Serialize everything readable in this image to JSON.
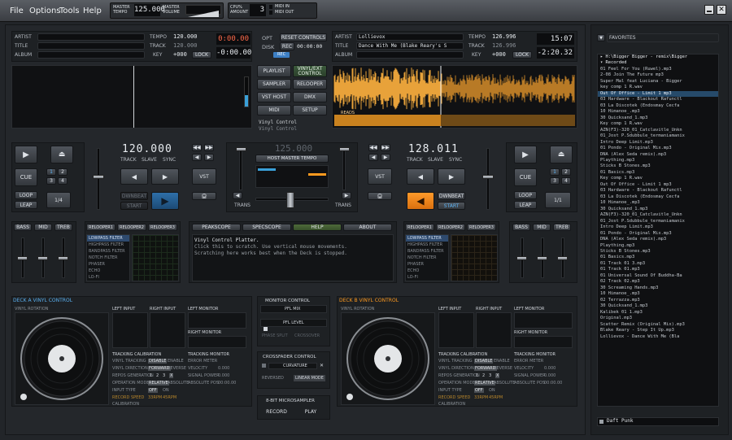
{
  "menu": {
    "file": "File",
    "options": "Options",
    "tools": "Tools",
    "help": "Help"
  },
  "topbar": {
    "master_tempo_label": "MASTER TEMPO",
    "master_tempo_value": "125.000",
    "master_volume_label": "MASTER VOLUME",
    "cpu_label": "CPU% AMOUNT",
    "cpu_value": "3",
    "midi_in": "MIDI IN",
    "midi_out": "MIDI OUT"
  },
  "deckA": {
    "artist_label": "ARTIST",
    "title_label": "TITLE",
    "album_label": "ALBUM",
    "tempo_label": "TEMPO",
    "tempo_value": "120.000",
    "track_label": "TRACK",
    "track_value": "120.000",
    "key_label": "KEY",
    "key_value": "+000",
    "lock": "LOCK",
    "time1": "0:00.00",
    "time2": "-0:00.00",
    "bpm": "120.000",
    "track_btn": "TRACK",
    "slave_btn": "SLAVE",
    "sync_btn": "SYNC",
    "cue": "CUE",
    "loop": "LOOP",
    "leap": "LEAP",
    "loop_val": "1/4",
    "dwnbeat": "DWNBEAT",
    "start": "START",
    "vst": "VST",
    "cue_nums": [
      "1",
      "2",
      "3",
      "4"
    ]
  },
  "deckB": {
    "artist_label": "ARTIST",
    "artist_value": "Lollievox",
    "title_label": "TITLE",
    "title_value": "Dance With Me (Blake Reary's S",
    "album_label": "ALBUM",
    "tempo_label": "TEMPO",
    "tempo_value": "126.996",
    "track_label": "TRACK",
    "track_value": "126.996",
    "key_label": "KEY",
    "key_value": "+000",
    "lock": "LOCK",
    "time1": "15:07",
    "time2": "-2:20.32",
    "bpm": "128.011",
    "track_btn": "TRACK",
    "slave_btn": "SLAVE",
    "sync_btn": "SYNC",
    "cue": "CUE",
    "loop": "LOOP",
    "leap": "LEAP",
    "loop_val": "1/1",
    "dwnbeat": "DWNBEAT",
    "start": "START",
    "vst": "VST",
    "cue_nums": [
      "1",
      "2",
      "3",
      "4"
    ],
    "reads": "READS"
  },
  "center": {
    "opt": "OPT",
    "reset": "RESET CONTROLS",
    "disk": "DISK",
    "rec": "REC",
    "rec_time": "00:00:00",
    "rec_badge": "REC",
    "playlist": "PLAYLIST",
    "vinyl_ext": "VINYL/EXT CONTROL",
    "sampler": "SAMPLER",
    "relooper": "RELOOPER",
    "vst_host": "VST HOST",
    "dmx": "DMX",
    "midi": "MIDI",
    "setup": "SETUP",
    "vinyl_line1": "Vinyl Control",
    "vinyl_line2": "Vinyl Control",
    "master_bpm": "125.000",
    "host_master_tempo": "HOST MASTER TEMPO",
    "trans": "TRANS"
  },
  "fx": {
    "bass": "BASS",
    "mid": "MID",
    "treb": "TREB",
    "relooper1": "RELOOPER1",
    "relooper2": "RELOOPER2",
    "relooper3": "RELOOPER3",
    "effects": [
      "LOWPASS FILTER",
      "HIGHPASS FILTER",
      "BANDPASS FILTER",
      "NOTCH FILTER",
      "PHASER",
      "ECHO",
      "LO-FI"
    ],
    "peakscope": "PEAKSCOPE",
    "specscope": "SPECSCOPE",
    "help": "HELP",
    "about": "ABOUT",
    "help_text1": "Vinyl Control Platter.",
    "help_text2": "Click this to scratch. Use vertical mouse movements.",
    "help_text3": "Scratching here works best when the Deck is stopped."
  },
  "vinylA": {
    "title": "DECK A VINYL CONTROL",
    "vinyl_rotation": "VINYL ROTATION",
    "left_input": "LEFT INPUT",
    "right_input": "RIGHT INPUT",
    "left_monitor": "LEFT MONITOR",
    "right_monitor": "RIGHT MONITOR",
    "tracking_cal": "TRACKING CALIBRATION",
    "tracking_mon": "TRACKING MONITOR",
    "rows": [
      [
        "VINYL TRACKING",
        "DISABLE",
        "ENABLE",
        "ERROR METER"
      ],
      [
        "VINYL DIRECTION",
        "FORWARD",
        "REVERSE",
        "VELOCITY",
        "0.000"
      ],
      [
        "REPOS GENERATION",
        "1",
        "2",
        "3",
        "X",
        "SIGNAL POWER",
        "0.000"
      ],
      [
        "OPERATION MODE",
        "RELATIVE",
        "ABSOLUTE",
        "ABSOLUTE POS",
        "00:00.00"
      ],
      [
        "INPUT TYPE",
        "OFF",
        "ON"
      ],
      [
        "RECORD SPEED",
        "33RPM",
        "45RPM"
      ],
      [
        "CALIBRATION"
      ]
    ]
  },
  "vinylB": {
    "title": "DECK B VINYL CONTROL",
    "vinyl_rotation": "VINYL ROTATION",
    "left_input": "LEFT INPUT",
    "right_input": "RIGHT INPUT",
    "left_monitor": "LEFT MONITOR",
    "right_monitor": "RIGHT MONITOR",
    "tracking_cal": "TRACKING CALIBRATION",
    "tracking_mon": "TRACKING MONITOR",
    "rows": [
      [
        "VINYL TRACKING",
        "DISABLE",
        "ENABLE",
        "ERROR METER"
      ],
      [
        "VINYL DIRECTION",
        "FORWARD",
        "REVERSE",
        "VELOCITY",
        "0.000"
      ],
      [
        "REPOS GENERATION",
        "1",
        "2",
        "3",
        "X",
        "SIGNAL POWER",
        "0.000"
      ],
      [
        "OPERATION MODE",
        "RELATIVE",
        "ABSOLUTE",
        "ABSOLUTE POS",
        "00:00.00"
      ],
      [
        "INPUT TYPE",
        "OFF",
        "ON"
      ],
      [
        "RECORD SPEED",
        "33RPM",
        "45RPM"
      ],
      [
        "CALIBRATION"
      ]
    ]
  },
  "monitor": {
    "title": "MONITOR CONTROL",
    "pfl_mix": "PFL MIX",
    "pfl_level": "PFL LEVEL",
    "phase_split": "PHASE SPLIT",
    "crossover": "CROSSOVER"
  },
  "crossfader": {
    "title": "CROSSFADER CONTROL",
    "curvature": "CURVATURE",
    "reversed": "REVERSED",
    "linear_mode": "LINEAR MODE"
  },
  "sampler": {
    "title": "8-BIT MICROSAMPLER",
    "record": "RECORD",
    "play": "PLAY"
  },
  "favorites": {
    "label": "FAVORITES",
    "path": "H:\\Bigger Bigger - remix\\Bigger",
    "recorded": "Recorded",
    "items": [
      "01 Feel For You (Ruwel).mp3",
      "2-08 Join The Future mp3",
      "Super Mal feat Luciana - Bigger",
      "key comp 1 R.wav",
      "Out Of Office - Limit 1 mp3",
      "03 Hardware - Blackout Rafunctl",
      "03 La Discotek (Endosmay Cecfa",
      "10 Himanoe_.mp3",
      "30 Quicksand_1.mp3",
      "Key comp 1 R.wav",
      "AZN(F3)-320_01_Catclavitle_Unkn",
      "01_Jost P.Sdubbule_termaniamanix",
      "Intro Deep Limit.mp3",
      "01 Pondo - Original Mix.mp3",
      "DNA (Alex Seda remix).mp3",
      "Plaything.mp3",
      "Sticks B Stones.mp3",
      "01 Basics.mp3",
      "Key comp 1 R.wav",
      "Out Of Office - Limit 1 mp3",
      "03 Hardware - Blackout Rafunctl",
      "03 La Discotek (Endosmay Cecfa",
      "10 Himanoe_.mp3",
      "30 Quicksand_1.mp3",
      "AZN(F3)-320_01_Catclavitle_Unkn",
      "01_Jost P.Sdubbule_termaniamanix",
      "Intro Deep Limit.mp3",
      "01 Pondo - Original Mix.mp3",
      "DNA (Alex Seda remix).mp3",
      "Plaything.mp3",
      "Sticks B Stones.mp3",
      "01 Basics.mp3",
      "01 Track 01 3.mp3",
      "01 Track 01.mp3",
      "01 Universal Sound Of Buddha-Ba",
      "02 Track 02.mp3",
      "30 Screaming Hands.mp3",
      "10 Himanoe_.mp3",
      "02 Terrazza.mp3",
      "30 Quicksand_1.mp3",
      "Kalibek 01 1.mp3",
      "Original.mp3",
      "Scatter Remix (Original Mix).mp3",
      "Blake Reary - Step It Up.mp3",
      "Lollievox - Dance With Me (Bla"
    ],
    "selected_index": 4,
    "search": "Daft Punk"
  }
}
